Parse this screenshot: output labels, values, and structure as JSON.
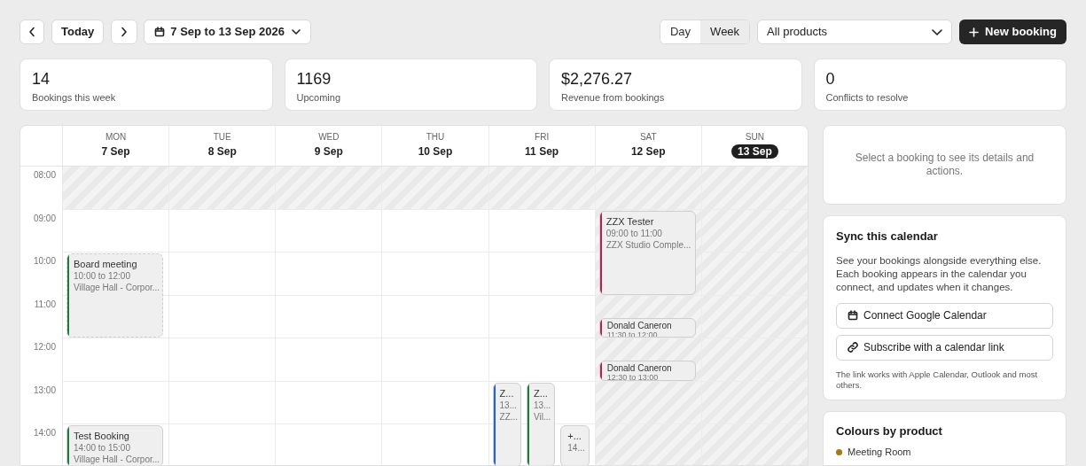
{
  "toolbar": {
    "today": "Today",
    "range": "7 Sep to 13 Sep 2026",
    "views": [
      {
        "label": "Day",
        "selected": false
      },
      {
        "label": "Week",
        "selected": true
      }
    ],
    "product_filter": "All products",
    "new_booking": "New booking"
  },
  "stats": [
    {
      "value": "14",
      "label": "Bookings this week"
    },
    {
      "value": "1169",
      "label": "Upcoming"
    },
    {
      "value": "$2,276.27",
      "label": "Revenue from bookings"
    },
    {
      "value": "0",
      "label": "Conflicts to resolve"
    }
  ],
  "calendar": {
    "hours": [
      "08:00",
      "09:00",
      "10:00",
      "11:00",
      "12:00",
      "13:00",
      "14:00"
    ],
    "days": [
      {
        "weekday": "MON",
        "date": "7 Sep",
        "selected": false,
        "weekend": false,
        "events": [
          {
            "title": "Board meeting",
            "time": "10:00 to 12:00",
            "place": "Village Hall - Corpor...",
            "color": "#1e7a3c",
            "provisional": true
          },
          {
            "title": "Test Booking",
            "time": "14:00 to 15:00",
            "place": "Village Hall - Corpor...",
            "color": "#1e7a3c",
            "provisional": false
          }
        ]
      },
      {
        "weekday": "TUE",
        "date": "8 Sep",
        "selected": false,
        "weekend": false
      },
      {
        "weekday": "WED",
        "date": "9 Sep",
        "selected": false,
        "weekend": false
      },
      {
        "weekday": "THU",
        "date": "10 Sep",
        "selected": false,
        "weekend": false
      },
      {
        "weekday": "FRI",
        "date": "11 Sep",
        "selected": false,
        "weekend": false,
        "events": [
          {
            "title": "Z...",
            "time": "13...",
            "place": "ZZ...",
            "color": "#2563c9",
            "provisional": false
          },
          {
            "title": "Z...",
            "time": "13...",
            "place": "Vil...",
            "color": "#1e7a3c",
            "provisional": false
          },
          {
            "title": "+...",
            "time": "14...",
            "provisional": false
          }
        ]
      },
      {
        "weekday": "SAT",
        "date": "12 Sep",
        "selected": false,
        "weekend": true,
        "events": [
          {
            "title": "ZZX Tester",
            "time": "09:00 to 11:00",
            "place": "ZZX Studio Comple...",
            "color": "#b0245a",
            "provisional": false
          },
          {
            "title": "Donald Caneron",
            "time": "11:30 to 12:00",
            "color": "#b0245a",
            "provisional": false
          },
          {
            "title": "Donald Caneron",
            "time": "12:30 to 13:00",
            "color": "#b0245a",
            "provisional": false
          }
        ]
      },
      {
        "weekday": "SUN",
        "date": "13 Sep",
        "selected": true,
        "weekend": true
      }
    ]
  },
  "details": {
    "placeholder": "Select a booking to see its details and actions."
  },
  "sync": {
    "title": "Sync this calendar",
    "text": "See your bookings alongside everything else. Each booking appears in the calendar you connect, and updates when it changes.",
    "buttons": [
      {
        "kind": "calendar",
        "label": "Connect Google Calendar"
      },
      {
        "kind": "link",
        "label": "Subscribe with a calendar link"
      }
    ],
    "note": "The link works with Apple Calendar, Outlook and most others."
  },
  "colours": {
    "title": "Colours by product",
    "items": [
      {
        "label": "Meeting Room",
        "color": "#a8780e"
      }
    ]
  }
}
